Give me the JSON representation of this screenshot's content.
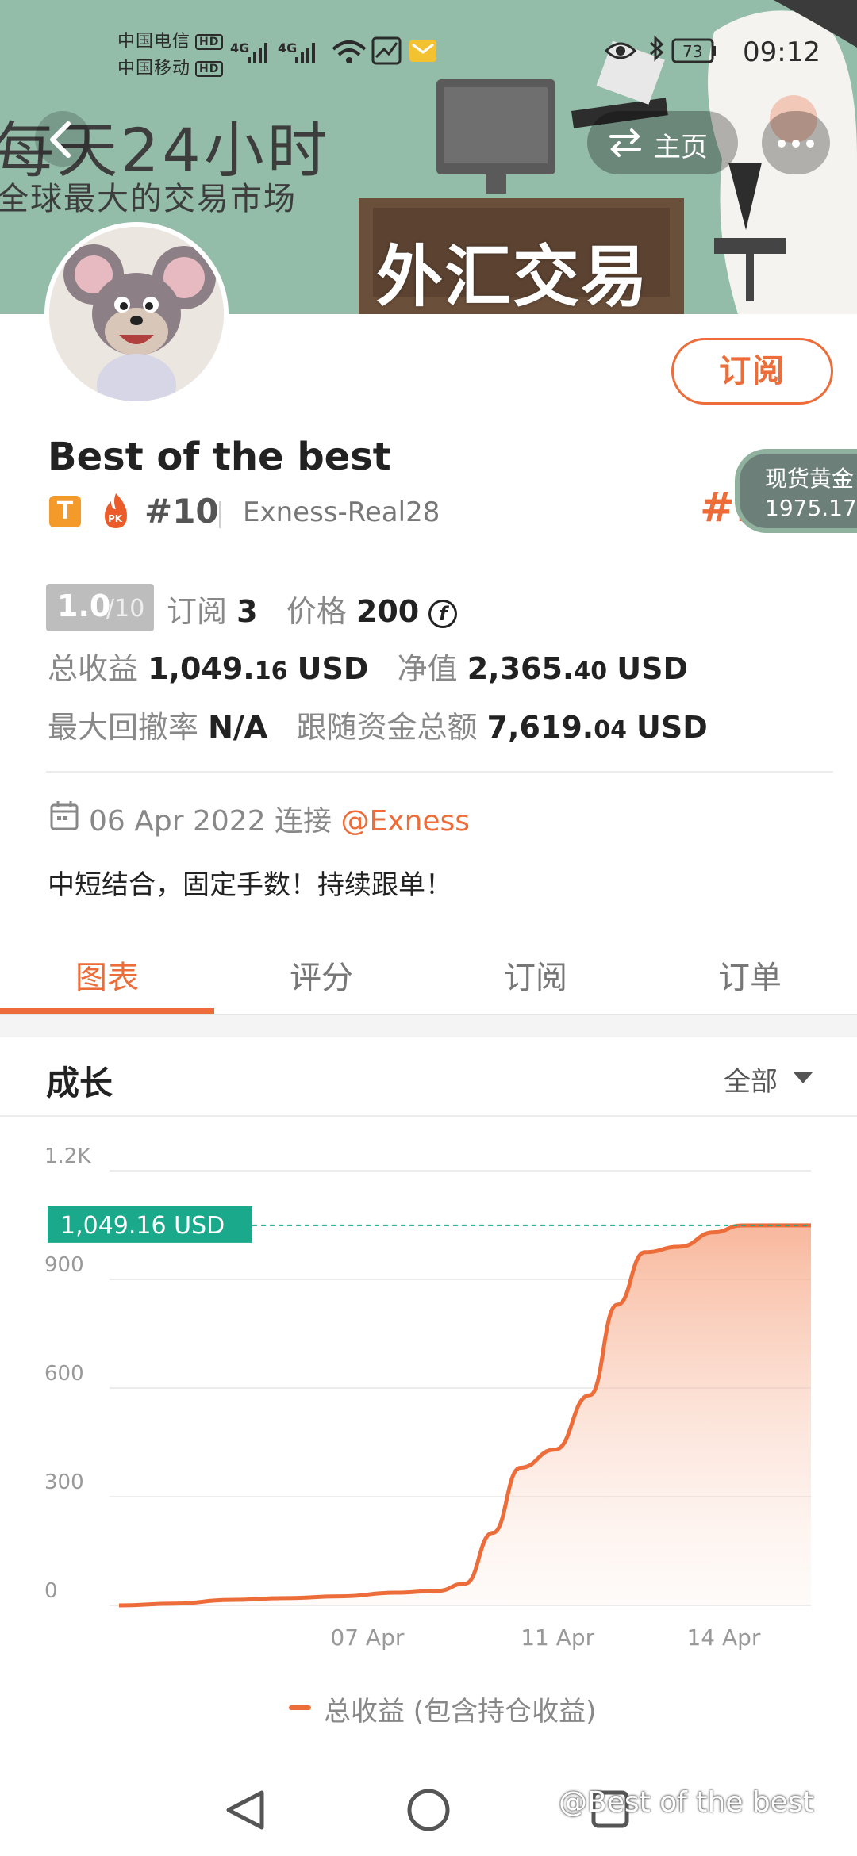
{
  "status_bar": {
    "carrier1": "中国电信",
    "carrier2": "中国移动",
    "hd": "HD",
    "network1": "4G",
    "network2": "4G",
    "battery": "73",
    "time": "09:12"
  },
  "banner": {
    "title": "每天24小时",
    "subtitle": "全球最大的交易市场",
    "sign": "外汇交易"
  },
  "header": {
    "home_label": "主页"
  },
  "profile": {
    "name": "Best of the best",
    "badge": "T",
    "pk_label": "PK",
    "rank": "#10",
    "account": "Exness-Real28",
    "subscribe_label": "订阅",
    "rank_overlay": "#10"
  },
  "gold_ticker": {
    "label": "现货黄金",
    "price": "1975.17"
  },
  "stats": {
    "score": "1.0",
    "score_max": "/10",
    "subscriptions_label": "订阅",
    "subscriptions_value": "3",
    "price_label": "价格",
    "price_value": "200",
    "coin_symbol": "f",
    "total_profit_label": "总收益",
    "total_profit_int": "1,049.",
    "total_profit_dec": "16",
    "total_profit_unit": "USD",
    "equity_label": "净值",
    "equity_int": "2,365.",
    "equity_dec": "40",
    "equity_unit": "USD",
    "max_drawdown_label": "最大回撤率",
    "max_drawdown_value": "N/A",
    "follow_funds_label": "跟随资金总额",
    "follow_funds_int": "7,619.",
    "follow_funds_dec": "04",
    "follow_funds_unit": "USD"
  },
  "connection": {
    "date": "06 Apr 2022",
    "connect_label": "连接",
    "broker": "@Exness"
  },
  "description": "中短结合，固定手数！持续跟单！",
  "tabs": [
    "图表",
    "评分",
    "订阅",
    "订单"
  ],
  "chart_section": {
    "title": "成长",
    "range": "全部"
  },
  "chart_data": {
    "type": "area",
    "ylim": [
      0,
      1200
    ],
    "y_ticks": [
      "0",
      "300",
      "600",
      "900",
      "1.2K"
    ],
    "x_ticks": [
      "07 Apr",
      "11 Apr",
      "14 Apr"
    ],
    "current_value_label": "1,049.16 USD",
    "current_value": 1049.16,
    "series": [
      {
        "name": "总收益 (包含持仓收益)",
        "color": "#ec6d3a",
        "points": [
          [
            0,
            0
          ],
          [
            0.08,
            5
          ],
          [
            0.16,
            15
          ],
          [
            0.24,
            20
          ],
          [
            0.32,
            25
          ],
          [
            0.4,
            35
          ],
          [
            0.46,
            40
          ],
          [
            0.5,
            60
          ],
          [
            0.54,
            200
          ],
          [
            0.58,
            380
          ],
          [
            0.63,
            430
          ],
          [
            0.68,
            580
          ],
          [
            0.72,
            830
          ],
          [
            0.76,
            975
          ],
          [
            0.81,
            990
          ],
          [
            0.86,
            1030
          ],
          [
            0.9,
            1049
          ],
          [
            1.0,
            1049.16
          ]
        ]
      }
    ],
    "legend": "总收益 (包含持仓收益)"
  },
  "watermark": "@Best of the best"
}
